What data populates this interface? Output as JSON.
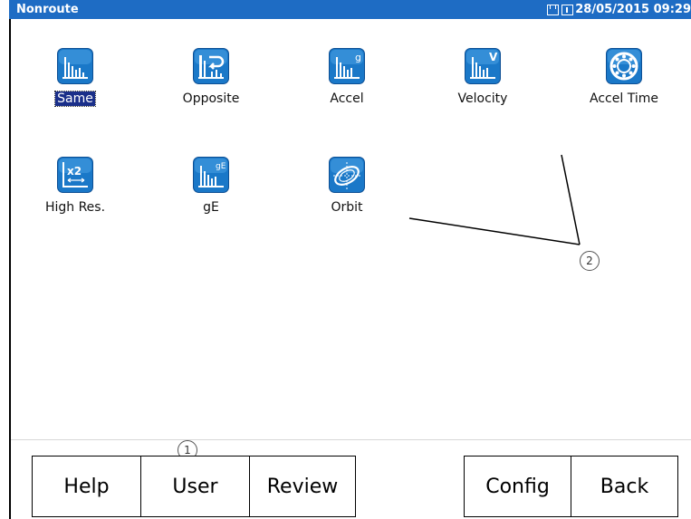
{
  "titlebar": {
    "title": "Nonroute",
    "datetime": "28/05/2015 09:29"
  },
  "apps": [
    {
      "label": "Same",
      "icon": "spectrum-same-icon",
      "selected": true
    },
    {
      "label": "Opposite",
      "icon": "spectrum-opposite-icon"
    },
    {
      "label": "Accel",
      "icon": "spectrum-accel-icon"
    },
    {
      "label": "Velocity",
      "icon": "spectrum-velocity-icon"
    },
    {
      "label": "Accel Time",
      "icon": "bearing-accel-time-icon"
    },
    {
      "label": "High Res.",
      "icon": "high-res-icon"
    },
    {
      "label": "gE",
      "icon": "spectrum-ge-icon"
    },
    {
      "label": "Orbit",
      "icon": "orbit-icon"
    }
  ],
  "callouts": {
    "one": "1",
    "two": "2"
  },
  "buttons": {
    "help": "Help",
    "user": "User",
    "review": "Review",
    "config": "Config",
    "back": "Back"
  },
  "colors": {
    "titlebar": "#1e6cc4",
    "icon_bg": "#1a78c8",
    "selected_label": "#1a2f8a"
  }
}
